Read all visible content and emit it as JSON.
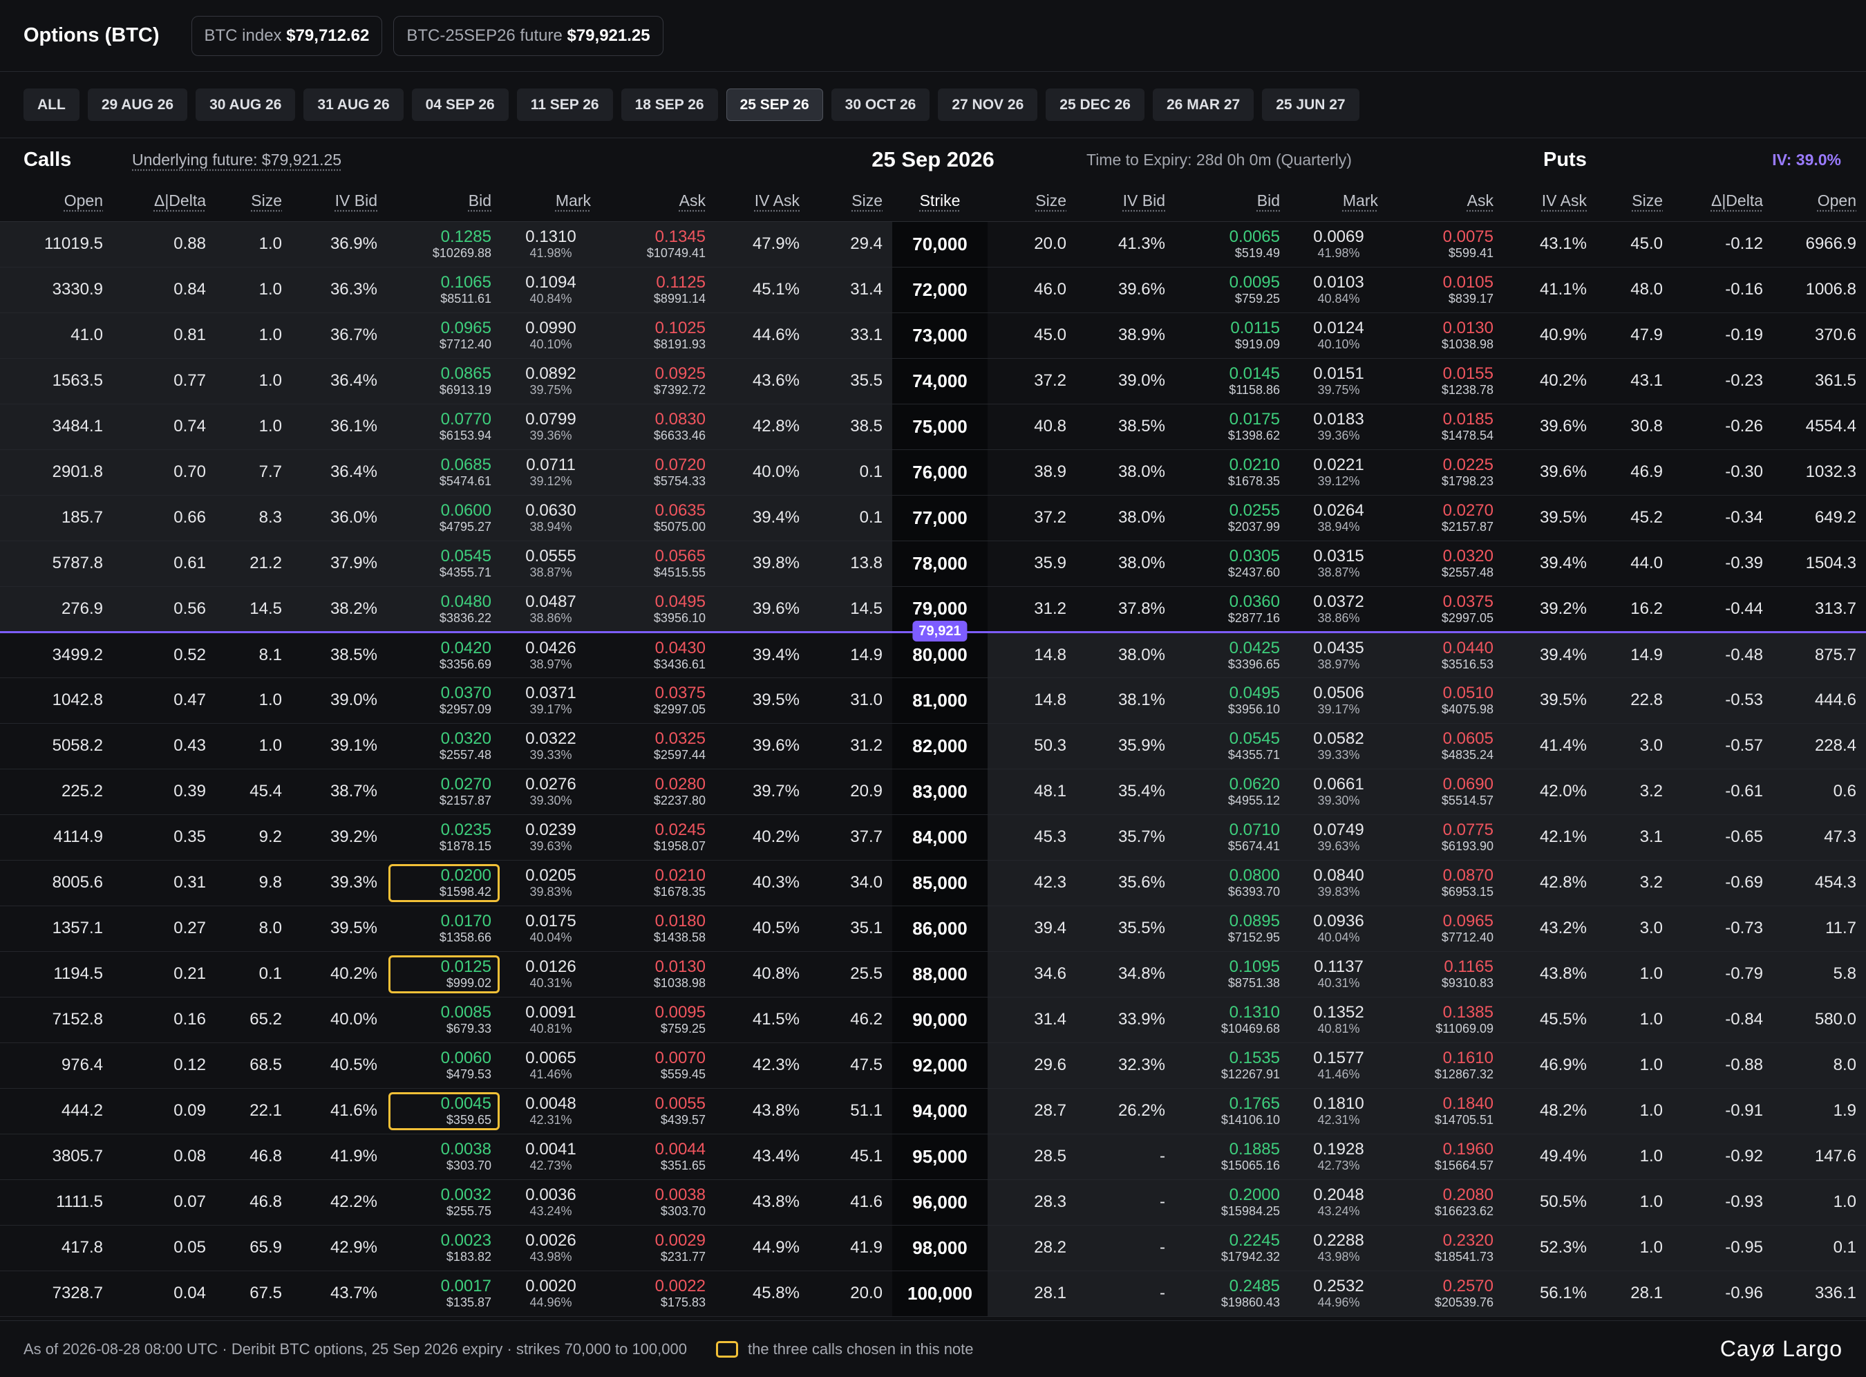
{
  "header": {
    "title": "Options (BTC)",
    "index_label": "BTC index",
    "index_value": "$79,712.62",
    "future_label": "BTC-25SEP26 future",
    "future_value": "$79,921.25"
  },
  "tabs": [
    "ALL",
    "29 AUG 26",
    "30 AUG 26",
    "31 AUG 26",
    "04 SEP 26",
    "11 SEP 26",
    "18 SEP 26",
    "25 SEP 26",
    "30 OCT 26",
    "27 NOV 26",
    "25 DEC 26",
    "26 MAR 27",
    "25 JUN 27"
  ],
  "active_tab": "25 SEP 26",
  "chain": {
    "calls_title": "Calls",
    "underlying": "Underlying future: $79,921.25",
    "expiry_title": "25 Sep 2026",
    "time_to_expiry": "Time to Expiry: 28d 0h 0m (Quarterly)",
    "puts_title": "Puts",
    "iv": "IV: 39.0%",
    "atm_label": "79,921"
  },
  "columns": {
    "calls": [
      "Open",
      "Δ|Delta",
      "Size",
      "IV Bid",
      "Bid",
      "Mark",
      "Ask",
      "IV Ask",
      "Size"
    ],
    "strike": "Strike",
    "puts": [
      "Size",
      "IV Bid",
      "Bid",
      "Mark",
      "Ask",
      "IV Ask",
      "Size",
      "Δ|Delta",
      "Open"
    ]
  },
  "colors": {
    "bid": "#3ecf7d",
    "ask": "#f0555e",
    "accent": "#7d5dff",
    "highlight": "#f2c037"
  },
  "rows": [
    {
      "strike": "70,000",
      "c": {
        "open": "11019.5",
        "delta": "0.88",
        "size": "1.0",
        "ivbid": "36.9%",
        "bid": "0.1285",
        "bid_usd": "$10269.88",
        "mark": "0.1310",
        "mark_iv": "41.98%",
        "ask": "0.1345",
        "ask_usd": "$10749.41",
        "ivask": "47.9%",
        "size2": "29.4"
      },
      "p": {
        "size": "20.0",
        "ivbid": "41.3%",
        "bid": "0.0065",
        "bid_usd": "$519.49",
        "mark": "0.0069",
        "mark_iv": "41.98%",
        "ask": "0.0075",
        "ask_usd": "$599.41",
        "ivask": "43.1%",
        "size2": "45.0",
        "delta": "-0.12",
        "open": "6966.9"
      }
    },
    {
      "strike": "72,000",
      "c": {
        "open": "3330.9",
        "delta": "0.84",
        "size": "1.0",
        "ivbid": "36.3%",
        "bid": "0.1065",
        "bid_usd": "$8511.61",
        "mark": "0.1094",
        "mark_iv": "40.84%",
        "ask": "0.1125",
        "ask_usd": "$8991.14",
        "ivask": "45.1%",
        "size2": "31.4"
      },
      "p": {
        "size": "46.0",
        "ivbid": "39.6%",
        "bid": "0.0095",
        "bid_usd": "$759.25",
        "mark": "0.0103",
        "mark_iv": "40.84%",
        "ask": "0.0105",
        "ask_usd": "$839.17",
        "ivask": "41.1%",
        "size2": "48.0",
        "delta": "-0.16",
        "open": "1006.8"
      }
    },
    {
      "strike": "73,000",
      "c": {
        "open": "41.0",
        "delta": "0.81",
        "size": "1.0",
        "ivbid": "36.7%",
        "bid": "0.0965",
        "bid_usd": "$7712.40",
        "mark": "0.0990",
        "mark_iv": "40.10%",
        "ask": "0.1025",
        "ask_usd": "$8191.93",
        "ivask": "44.6%",
        "size2": "33.1"
      },
      "p": {
        "size": "45.0",
        "ivbid": "38.9%",
        "bid": "0.0115",
        "bid_usd": "$919.09",
        "mark": "0.0124",
        "mark_iv": "40.10%",
        "ask": "0.0130",
        "ask_usd": "$1038.98",
        "ivask": "40.9%",
        "size2": "47.9",
        "delta": "-0.19",
        "open": "370.6"
      }
    },
    {
      "strike": "74,000",
      "c": {
        "open": "1563.5",
        "delta": "0.77",
        "size": "1.0",
        "ivbid": "36.4%",
        "bid": "0.0865",
        "bid_usd": "$6913.19",
        "mark": "0.0892",
        "mark_iv": "39.75%",
        "ask": "0.0925",
        "ask_usd": "$7392.72",
        "ivask": "43.6%",
        "size2": "35.5"
      },
      "p": {
        "size": "37.2",
        "ivbid": "39.0%",
        "bid": "0.0145",
        "bid_usd": "$1158.86",
        "mark": "0.0151",
        "mark_iv": "39.75%",
        "ask": "0.0155",
        "ask_usd": "$1238.78",
        "ivask": "40.2%",
        "size2": "43.1",
        "delta": "-0.23",
        "open": "361.5"
      }
    },
    {
      "strike": "75,000",
      "c": {
        "open": "3484.1",
        "delta": "0.74",
        "size": "1.0",
        "ivbid": "36.1%",
        "bid": "0.0770",
        "bid_usd": "$6153.94",
        "mark": "0.0799",
        "mark_iv": "39.36%",
        "ask": "0.0830",
        "ask_usd": "$6633.46",
        "ivask": "42.8%",
        "size2": "38.5"
      },
      "p": {
        "size": "40.8",
        "ivbid": "38.5%",
        "bid": "0.0175",
        "bid_usd": "$1398.62",
        "mark": "0.0183",
        "mark_iv": "39.36%",
        "ask": "0.0185",
        "ask_usd": "$1478.54",
        "ivask": "39.6%",
        "size2": "30.8",
        "delta": "-0.26",
        "open": "4554.4"
      }
    },
    {
      "strike": "76,000",
      "c": {
        "open": "2901.8",
        "delta": "0.70",
        "size": "7.7",
        "ivbid": "36.4%",
        "bid": "0.0685",
        "bid_usd": "$5474.61",
        "mark": "0.0711",
        "mark_iv": "39.12%",
        "ask": "0.0720",
        "ask_usd": "$5754.33",
        "ivask": "40.0%",
        "size2": "0.1"
      },
      "p": {
        "size": "38.9",
        "ivbid": "38.0%",
        "bid": "0.0210",
        "bid_usd": "$1678.35",
        "mark": "0.0221",
        "mark_iv": "39.12%",
        "ask": "0.0225",
        "ask_usd": "$1798.23",
        "ivask": "39.6%",
        "size2": "46.9",
        "delta": "-0.30",
        "open": "1032.3"
      }
    },
    {
      "strike": "77,000",
      "c": {
        "open": "185.7",
        "delta": "0.66",
        "size": "8.3",
        "ivbid": "36.0%",
        "bid": "0.0600",
        "bid_usd": "$4795.27",
        "mark": "0.0630",
        "mark_iv": "38.94%",
        "ask": "0.0635",
        "ask_usd": "$5075.00",
        "ivask": "39.4%",
        "size2": "0.1"
      },
      "p": {
        "size": "37.2",
        "ivbid": "38.0%",
        "bid": "0.0255",
        "bid_usd": "$2037.99",
        "mark": "0.0264",
        "mark_iv": "38.94%",
        "ask": "0.0270",
        "ask_usd": "$2157.87",
        "ivask": "39.5%",
        "size2": "45.2",
        "delta": "-0.34",
        "open": "649.2"
      }
    },
    {
      "strike": "78,000",
      "c": {
        "open": "5787.8",
        "delta": "0.61",
        "size": "21.2",
        "ivbid": "37.9%",
        "bid": "0.0545",
        "bid_usd": "$4355.71",
        "mark": "0.0555",
        "mark_iv": "38.87%",
        "ask": "0.0565",
        "ask_usd": "$4515.55",
        "ivask": "39.8%",
        "size2": "13.8"
      },
      "p": {
        "size": "35.9",
        "ivbid": "38.0%",
        "bid": "0.0305",
        "bid_usd": "$2437.60",
        "mark": "0.0315",
        "mark_iv": "38.87%",
        "ask": "0.0320",
        "ask_usd": "$2557.48",
        "ivask": "39.4%",
        "size2": "44.0",
        "delta": "-0.39",
        "open": "1504.3"
      }
    },
    {
      "strike": "79,000",
      "c": {
        "open": "276.9",
        "delta": "0.56",
        "size": "14.5",
        "ivbid": "38.2%",
        "bid": "0.0480",
        "bid_usd": "$3836.22",
        "mark": "0.0487",
        "mark_iv": "38.86%",
        "ask": "0.0495",
        "ask_usd": "$3956.10",
        "ivask": "39.6%",
        "size2": "14.5"
      },
      "p": {
        "size": "31.2",
        "ivbid": "37.8%",
        "bid": "0.0360",
        "bid_usd": "$2877.16",
        "mark": "0.0372",
        "mark_iv": "38.86%",
        "ask": "0.0375",
        "ask_usd": "$2997.05",
        "ivask": "39.2%",
        "size2": "16.2",
        "delta": "-0.44",
        "open": "313.7"
      }
    },
    {
      "strike": "80,000",
      "c": {
        "open": "3499.2",
        "delta": "0.52",
        "size": "8.1",
        "ivbid": "38.5%",
        "bid": "0.0420",
        "bid_usd": "$3356.69",
        "mark": "0.0426",
        "mark_iv": "38.97%",
        "ask": "0.0430",
        "ask_usd": "$3436.61",
        "ivask": "39.4%",
        "size2": "14.9"
      },
      "p": {
        "size": "14.8",
        "ivbid": "38.0%",
        "bid": "0.0425",
        "bid_usd": "$3396.65",
        "mark": "0.0435",
        "mark_iv": "38.97%",
        "ask": "0.0440",
        "ask_usd": "$3516.53",
        "ivask": "39.4%",
        "size2": "14.9",
        "delta": "-0.48",
        "open": "875.7"
      }
    },
    {
      "strike": "81,000",
      "c": {
        "open": "1042.8",
        "delta": "0.47",
        "size": "1.0",
        "ivbid": "39.0%",
        "bid": "0.0370",
        "bid_usd": "$2957.09",
        "mark": "0.0371",
        "mark_iv": "39.17%",
        "ask": "0.0375",
        "ask_usd": "$2997.05",
        "ivask": "39.5%",
        "size2": "31.0"
      },
      "p": {
        "size": "14.8",
        "ivbid": "38.1%",
        "bid": "0.0495",
        "bid_usd": "$3956.10",
        "mark": "0.0506",
        "mark_iv": "39.17%",
        "ask": "0.0510",
        "ask_usd": "$4075.98",
        "ivask": "39.5%",
        "size2": "22.8",
        "delta": "-0.53",
        "open": "444.6"
      }
    },
    {
      "strike": "82,000",
      "c": {
        "open": "5058.2",
        "delta": "0.43",
        "size": "1.0",
        "ivbid": "39.1%",
        "bid": "0.0320",
        "bid_usd": "$2557.48",
        "mark": "0.0322",
        "mark_iv": "39.33%",
        "ask": "0.0325",
        "ask_usd": "$2597.44",
        "ivask": "39.6%",
        "size2": "31.2"
      },
      "p": {
        "size": "50.3",
        "ivbid": "35.9%",
        "bid": "0.0545",
        "bid_usd": "$4355.71",
        "mark": "0.0582",
        "mark_iv": "39.33%",
        "ask": "0.0605",
        "ask_usd": "$4835.24",
        "ivask": "41.4%",
        "size2": "3.0",
        "delta": "-0.57",
        "open": "228.4"
      }
    },
    {
      "strike": "83,000",
      "c": {
        "open": "225.2",
        "delta": "0.39",
        "size": "45.4",
        "ivbid": "38.7%",
        "bid": "0.0270",
        "bid_usd": "$2157.87",
        "mark": "0.0276",
        "mark_iv": "39.30%",
        "ask": "0.0280",
        "ask_usd": "$2237.80",
        "ivask": "39.7%",
        "size2": "20.9"
      },
      "p": {
        "size": "48.1",
        "ivbid": "35.4%",
        "bid": "0.0620",
        "bid_usd": "$4955.12",
        "mark": "0.0661",
        "mark_iv": "39.30%",
        "ask": "0.0690",
        "ask_usd": "$5514.57",
        "ivask": "42.0%",
        "size2": "3.2",
        "delta": "-0.61",
        "open": "0.6"
      }
    },
    {
      "strike": "84,000",
      "c": {
        "open": "4114.9",
        "delta": "0.35",
        "size": "9.2",
        "ivbid": "39.2%",
        "bid": "0.0235",
        "bid_usd": "$1878.15",
        "mark": "0.0239",
        "mark_iv": "39.63%",
        "ask": "0.0245",
        "ask_usd": "$1958.07",
        "ivask": "40.2%",
        "size2": "37.7"
      },
      "p": {
        "size": "45.3",
        "ivbid": "35.7%",
        "bid": "0.0710",
        "bid_usd": "$5674.41",
        "mark": "0.0749",
        "mark_iv": "39.63%",
        "ask": "0.0775",
        "ask_usd": "$6193.90",
        "ivask": "42.1%",
        "size2": "3.1",
        "delta": "-0.65",
        "open": "47.3"
      }
    },
    {
      "strike": "85,000",
      "sel": true,
      "c": {
        "open": "8005.6",
        "delta": "0.31",
        "size": "9.8",
        "ivbid": "39.3%",
        "bid": "0.0200",
        "bid_usd": "$1598.42",
        "mark": "0.0205",
        "mark_iv": "39.83%",
        "ask": "0.0210",
        "ask_usd": "$1678.35",
        "ivask": "40.3%",
        "size2": "34.0"
      },
      "p": {
        "size": "42.3",
        "ivbid": "35.6%",
        "bid": "0.0800",
        "bid_usd": "$6393.70",
        "mark": "0.0840",
        "mark_iv": "39.83%",
        "ask": "0.0870",
        "ask_usd": "$6953.15",
        "ivask": "42.8%",
        "size2": "3.2",
        "delta": "-0.69",
        "open": "454.3"
      }
    },
    {
      "strike": "86,000",
      "c": {
        "open": "1357.1",
        "delta": "0.27",
        "size": "8.0",
        "ivbid": "39.5%",
        "bid": "0.0170",
        "bid_usd": "$1358.66",
        "mark": "0.0175",
        "mark_iv": "40.04%",
        "ask": "0.0180",
        "ask_usd": "$1438.58",
        "ivask": "40.5%",
        "size2": "35.1"
      },
      "p": {
        "size": "39.4",
        "ivbid": "35.5%",
        "bid": "0.0895",
        "bid_usd": "$7152.95",
        "mark": "0.0936",
        "mark_iv": "40.04%",
        "ask": "0.0965",
        "ask_usd": "$7712.40",
        "ivask": "43.2%",
        "size2": "3.0",
        "delta": "-0.73",
        "open": "11.7"
      }
    },
    {
      "strike": "88,000",
      "sel": true,
      "c": {
        "open": "1194.5",
        "delta": "0.21",
        "size": "0.1",
        "ivbid": "40.2%",
        "bid": "0.0125",
        "bid_usd": "$999.02",
        "mark": "0.0126",
        "mark_iv": "40.31%",
        "ask": "0.0130",
        "ask_usd": "$1038.98",
        "ivask": "40.8%",
        "size2": "25.5"
      },
      "p": {
        "size": "34.6",
        "ivbid": "34.8%",
        "bid": "0.1095",
        "bid_usd": "$8751.38",
        "mark": "0.1137",
        "mark_iv": "40.31%",
        "ask": "0.1165",
        "ask_usd": "$9310.83",
        "ivask": "43.8%",
        "size2": "1.0",
        "delta": "-0.79",
        "open": "5.8"
      }
    },
    {
      "strike": "90,000",
      "c": {
        "open": "7152.8",
        "delta": "0.16",
        "size": "65.2",
        "ivbid": "40.0%",
        "bid": "0.0085",
        "bid_usd": "$679.33",
        "mark": "0.0091",
        "mark_iv": "40.81%",
        "ask": "0.0095",
        "ask_usd": "$759.25",
        "ivask": "41.5%",
        "size2": "46.2"
      },
      "p": {
        "size": "31.4",
        "ivbid": "33.9%",
        "bid": "0.1310",
        "bid_usd": "$10469.68",
        "mark": "0.1352",
        "mark_iv": "40.81%",
        "ask": "0.1385",
        "ask_usd": "$11069.09",
        "ivask": "45.5%",
        "size2": "1.0",
        "delta": "-0.84",
        "open": "580.0"
      }
    },
    {
      "strike": "92,000",
      "c": {
        "open": "976.4",
        "delta": "0.12",
        "size": "68.5",
        "ivbid": "40.5%",
        "bid": "0.0060",
        "bid_usd": "$479.53",
        "mark": "0.0065",
        "mark_iv": "41.46%",
        "ask": "0.0070",
        "ask_usd": "$559.45",
        "ivask": "42.3%",
        "size2": "47.5"
      },
      "p": {
        "size": "29.6",
        "ivbid": "32.3%",
        "bid": "0.1535",
        "bid_usd": "$12267.91",
        "mark": "0.1577",
        "mark_iv": "41.46%",
        "ask": "0.1610",
        "ask_usd": "$12867.32",
        "ivask": "46.9%",
        "size2": "1.0",
        "delta": "-0.88",
        "open": "8.0"
      }
    },
    {
      "strike": "94,000",
      "sel": true,
      "c": {
        "open": "444.2",
        "delta": "0.09",
        "size": "22.1",
        "ivbid": "41.6%",
        "bid": "0.0045",
        "bid_usd": "$359.65",
        "mark": "0.0048",
        "mark_iv": "42.31%",
        "ask": "0.0055",
        "ask_usd": "$439.57",
        "ivask": "43.8%",
        "size2": "51.1"
      },
      "p": {
        "size": "28.7",
        "ivbid": "26.2%",
        "bid": "0.1765",
        "bid_usd": "$14106.10",
        "mark": "0.1810",
        "mark_iv": "42.31%",
        "ask": "0.1840",
        "ask_usd": "$14705.51",
        "ivask": "48.2%",
        "size2": "1.0",
        "delta": "-0.91",
        "open": "1.9"
      }
    },
    {
      "strike": "95,000",
      "c": {
        "open": "3805.7",
        "delta": "0.08",
        "size": "46.8",
        "ivbid": "41.9%",
        "bid": "0.0038",
        "bid_usd": "$303.70",
        "mark": "0.0041",
        "mark_iv": "42.73%",
        "ask": "0.0044",
        "ask_usd": "$351.65",
        "ivask": "43.4%",
        "size2": "45.1"
      },
      "p": {
        "size": "28.5",
        "ivbid": "-",
        "bid": "0.1885",
        "bid_usd": "$15065.16",
        "mark": "0.1928",
        "mark_iv": "42.73%",
        "ask": "0.1960",
        "ask_usd": "$15664.57",
        "ivask": "49.4%",
        "size2": "1.0",
        "delta": "-0.92",
        "open": "147.6"
      }
    },
    {
      "strike": "96,000",
      "c": {
        "open": "1111.5",
        "delta": "0.07",
        "size": "46.8",
        "ivbid": "42.2%",
        "bid": "0.0032",
        "bid_usd": "$255.75",
        "mark": "0.0036",
        "mark_iv": "43.24%",
        "ask": "0.0038",
        "ask_usd": "$303.70",
        "ivask": "43.8%",
        "size2": "41.6"
      },
      "p": {
        "size": "28.3",
        "ivbid": "-",
        "bid": "0.2000",
        "bid_usd": "$15984.25",
        "mark": "0.2048",
        "mark_iv": "43.24%",
        "ask": "0.2080",
        "ask_usd": "$16623.62",
        "ivask": "50.5%",
        "size2": "1.0",
        "delta": "-0.93",
        "open": "1.0"
      }
    },
    {
      "strike": "98,000",
      "c": {
        "open": "417.8",
        "delta": "0.05",
        "size": "65.9",
        "ivbid": "42.9%",
        "bid": "0.0023",
        "bid_usd": "$183.82",
        "mark": "0.0026",
        "mark_iv": "43.98%",
        "ask": "0.0029",
        "ask_usd": "$231.77",
        "ivask": "44.9%",
        "size2": "41.9"
      },
      "p": {
        "size": "28.2",
        "ivbid": "-",
        "bid": "0.2245",
        "bid_usd": "$17942.32",
        "mark": "0.2288",
        "mark_iv": "43.98%",
        "ask": "0.2320",
        "ask_usd": "$18541.73",
        "ivask": "52.3%",
        "size2": "1.0",
        "delta": "-0.95",
        "open": "0.1"
      }
    },
    {
      "strike": "100,000",
      "c": {
        "open": "7328.7",
        "delta": "0.04",
        "size": "67.5",
        "ivbid": "43.7%",
        "bid": "0.0017",
        "bid_usd": "$135.87",
        "mark": "0.0020",
        "mark_iv": "44.96%",
        "ask": "0.0022",
        "ask_usd": "$175.83",
        "ivask": "45.8%",
        "size2": "20.0"
      },
      "p": {
        "size": "28.1",
        "ivbid": "-",
        "bid": "0.2485",
        "bid_usd": "$19860.43",
        "mark": "0.2532",
        "mark_iv": "44.96%",
        "ask": "0.2570",
        "ask_usd": "$20539.76",
        "ivask": "56.1%",
        "size2": "28.1",
        "delta": "-0.96",
        "open": "336.1"
      }
    }
  ],
  "footer": {
    "note": "As of 2026-08-28 08:00 UTC · Deribit BTC options, 25 Sep 2026 expiry · strikes 70,000 to 100,000",
    "legend": "the three calls chosen in this note",
    "brand": "Cayø Largo"
  }
}
